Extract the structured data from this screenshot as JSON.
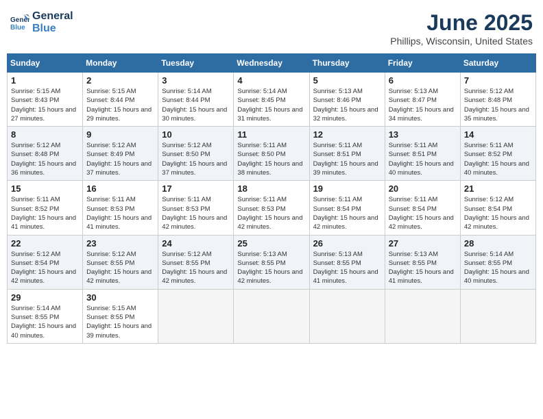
{
  "header": {
    "logo_line1": "General",
    "logo_line2": "Blue",
    "month": "June 2025",
    "location": "Phillips, Wisconsin, United States"
  },
  "days_of_week": [
    "Sunday",
    "Monday",
    "Tuesday",
    "Wednesday",
    "Thursday",
    "Friday",
    "Saturday"
  ],
  "weeks": [
    [
      {
        "day": "1",
        "sunrise": "Sunrise: 5:15 AM",
        "sunset": "Sunset: 8:43 PM",
        "daylight": "Daylight: 15 hours and 27 minutes."
      },
      {
        "day": "2",
        "sunrise": "Sunrise: 5:15 AM",
        "sunset": "Sunset: 8:44 PM",
        "daylight": "Daylight: 15 hours and 29 minutes."
      },
      {
        "day": "3",
        "sunrise": "Sunrise: 5:14 AM",
        "sunset": "Sunset: 8:44 PM",
        "daylight": "Daylight: 15 hours and 30 minutes."
      },
      {
        "day": "4",
        "sunrise": "Sunrise: 5:14 AM",
        "sunset": "Sunset: 8:45 PM",
        "daylight": "Daylight: 15 hours and 31 minutes."
      },
      {
        "day": "5",
        "sunrise": "Sunrise: 5:13 AM",
        "sunset": "Sunset: 8:46 PM",
        "daylight": "Daylight: 15 hours and 32 minutes."
      },
      {
        "day": "6",
        "sunrise": "Sunrise: 5:13 AM",
        "sunset": "Sunset: 8:47 PM",
        "daylight": "Daylight: 15 hours and 34 minutes."
      },
      {
        "day": "7",
        "sunrise": "Sunrise: 5:12 AM",
        "sunset": "Sunset: 8:48 PM",
        "daylight": "Daylight: 15 hours and 35 minutes."
      }
    ],
    [
      {
        "day": "8",
        "sunrise": "Sunrise: 5:12 AM",
        "sunset": "Sunset: 8:48 PM",
        "daylight": "Daylight: 15 hours and 36 minutes."
      },
      {
        "day": "9",
        "sunrise": "Sunrise: 5:12 AM",
        "sunset": "Sunset: 8:49 PM",
        "daylight": "Daylight: 15 hours and 37 minutes."
      },
      {
        "day": "10",
        "sunrise": "Sunrise: 5:12 AM",
        "sunset": "Sunset: 8:50 PM",
        "daylight": "Daylight: 15 hours and 37 minutes."
      },
      {
        "day": "11",
        "sunrise": "Sunrise: 5:11 AM",
        "sunset": "Sunset: 8:50 PM",
        "daylight": "Daylight: 15 hours and 38 minutes."
      },
      {
        "day": "12",
        "sunrise": "Sunrise: 5:11 AM",
        "sunset": "Sunset: 8:51 PM",
        "daylight": "Daylight: 15 hours and 39 minutes."
      },
      {
        "day": "13",
        "sunrise": "Sunrise: 5:11 AM",
        "sunset": "Sunset: 8:51 PM",
        "daylight": "Daylight: 15 hours and 40 minutes."
      },
      {
        "day": "14",
        "sunrise": "Sunrise: 5:11 AM",
        "sunset": "Sunset: 8:52 PM",
        "daylight": "Daylight: 15 hours and 40 minutes."
      }
    ],
    [
      {
        "day": "15",
        "sunrise": "Sunrise: 5:11 AM",
        "sunset": "Sunset: 8:52 PM",
        "daylight": "Daylight: 15 hours and 41 minutes."
      },
      {
        "day": "16",
        "sunrise": "Sunrise: 5:11 AM",
        "sunset": "Sunset: 8:53 PM",
        "daylight": "Daylight: 15 hours and 41 minutes."
      },
      {
        "day": "17",
        "sunrise": "Sunrise: 5:11 AM",
        "sunset": "Sunset: 8:53 PM",
        "daylight": "Daylight: 15 hours and 42 minutes."
      },
      {
        "day": "18",
        "sunrise": "Sunrise: 5:11 AM",
        "sunset": "Sunset: 8:53 PM",
        "daylight": "Daylight: 15 hours and 42 minutes."
      },
      {
        "day": "19",
        "sunrise": "Sunrise: 5:11 AM",
        "sunset": "Sunset: 8:54 PM",
        "daylight": "Daylight: 15 hours and 42 minutes."
      },
      {
        "day": "20",
        "sunrise": "Sunrise: 5:11 AM",
        "sunset": "Sunset: 8:54 PM",
        "daylight": "Daylight: 15 hours and 42 minutes."
      },
      {
        "day": "21",
        "sunrise": "Sunrise: 5:12 AM",
        "sunset": "Sunset: 8:54 PM",
        "daylight": "Daylight: 15 hours and 42 minutes."
      }
    ],
    [
      {
        "day": "22",
        "sunrise": "Sunrise: 5:12 AM",
        "sunset": "Sunset: 8:54 PM",
        "daylight": "Daylight: 15 hours and 42 minutes."
      },
      {
        "day": "23",
        "sunrise": "Sunrise: 5:12 AM",
        "sunset": "Sunset: 8:55 PM",
        "daylight": "Daylight: 15 hours and 42 minutes."
      },
      {
        "day": "24",
        "sunrise": "Sunrise: 5:12 AM",
        "sunset": "Sunset: 8:55 PM",
        "daylight": "Daylight: 15 hours and 42 minutes."
      },
      {
        "day": "25",
        "sunrise": "Sunrise: 5:13 AM",
        "sunset": "Sunset: 8:55 PM",
        "daylight": "Daylight: 15 hours and 42 minutes."
      },
      {
        "day": "26",
        "sunrise": "Sunrise: 5:13 AM",
        "sunset": "Sunset: 8:55 PM",
        "daylight": "Daylight: 15 hours and 41 minutes."
      },
      {
        "day": "27",
        "sunrise": "Sunrise: 5:13 AM",
        "sunset": "Sunset: 8:55 PM",
        "daylight": "Daylight: 15 hours and 41 minutes."
      },
      {
        "day": "28",
        "sunrise": "Sunrise: 5:14 AM",
        "sunset": "Sunset: 8:55 PM",
        "daylight": "Daylight: 15 hours and 40 minutes."
      }
    ],
    [
      {
        "day": "29",
        "sunrise": "Sunrise: 5:14 AM",
        "sunset": "Sunset: 8:55 PM",
        "daylight": "Daylight: 15 hours and 40 minutes."
      },
      {
        "day": "30",
        "sunrise": "Sunrise: 5:15 AM",
        "sunset": "Sunset: 8:55 PM",
        "daylight": "Daylight: 15 hours and 39 minutes."
      },
      {
        "day": "",
        "sunrise": "",
        "sunset": "",
        "daylight": ""
      },
      {
        "day": "",
        "sunrise": "",
        "sunset": "",
        "daylight": ""
      },
      {
        "day": "",
        "sunrise": "",
        "sunset": "",
        "daylight": ""
      },
      {
        "day": "",
        "sunrise": "",
        "sunset": "",
        "daylight": ""
      },
      {
        "day": "",
        "sunrise": "",
        "sunset": "",
        "daylight": ""
      }
    ]
  ]
}
